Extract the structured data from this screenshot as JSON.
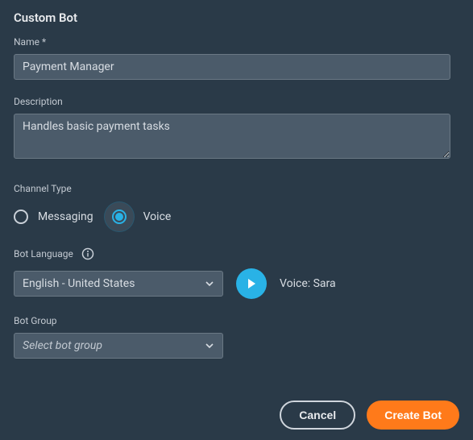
{
  "header": {
    "title": "Custom Bot"
  },
  "name_field": {
    "label": "Name *",
    "value": "Payment Manager"
  },
  "description_field": {
    "label": "Description",
    "value": "Handles basic payment tasks"
  },
  "channel_type": {
    "label": "Channel Type",
    "options": [
      {
        "label": "Messaging",
        "selected": false
      },
      {
        "label": "Voice",
        "selected": true
      }
    ]
  },
  "bot_language": {
    "label": "Bot Language",
    "selected": "English - United States",
    "voice_label": "Voice: Sara"
  },
  "bot_group": {
    "label": "Bot Group",
    "placeholder": "Select bot group"
  },
  "footer": {
    "cancel": "Cancel",
    "create": "Create Bot"
  }
}
